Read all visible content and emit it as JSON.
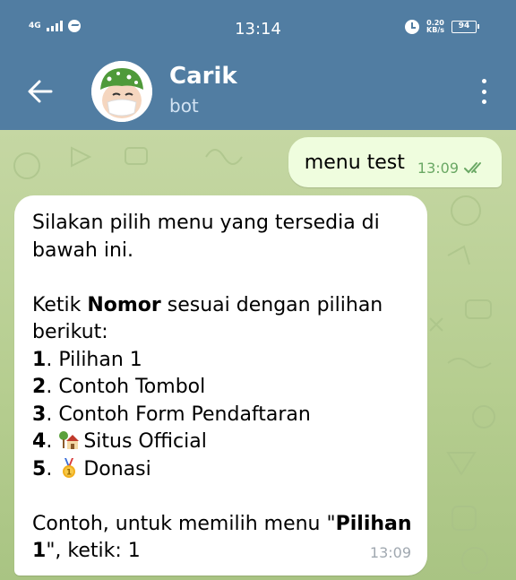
{
  "status_bar": {
    "network": "4G",
    "time": "13:14",
    "speed_value": "0.20",
    "speed_unit": "KB/s",
    "battery": "94"
  },
  "header": {
    "title": "Carik",
    "subtitle": "bot"
  },
  "messages": {
    "outgoing": {
      "text": "menu test",
      "time": "13:09"
    },
    "incoming": {
      "intro_1": "Silakan pilih menu yang tersedia di",
      "intro_2": "bawah ini.",
      "prompt_a": "Ketik ",
      "prompt_bold": "Nomor",
      "prompt_b": " sesuai dengan pilihan",
      "prompt_2": "berikut:",
      "options": [
        {
          "num": "1",
          "sep": ". ",
          "label": "Pilihan 1"
        },
        {
          "num": "2",
          "sep": ". ",
          "label": "Contoh Tombol"
        },
        {
          "num": "3",
          "sep": ". ",
          "label": "Contoh Form Pendaftaran"
        },
        {
          "num": "4",
          "sep": ". ",
          "label": "Situs Official",
          "icon": "house-with-garden-icon"
        },
        {
          "num": "5",
          "sep": ". ",
          "label": "Donasi",
          "icon": "first-place-medal-icon"
        }
      ],
      "example_a": "Contoh, untuk memilih menu \"",
      "example_bold_1": "Pilihan",
      "example_bold_2": "1",
      "example_b": "\", ketik: 1",
      "time": "13:09"
    }
  },
  "colors": {
    "header": "#517da2",
    "chat_background": "#c5d7a3",
    "outgoing_bubble": "#effdde",
    "incoming_bubble": "#ffffff",
    "read_check": "#6aa864"
  }
}
